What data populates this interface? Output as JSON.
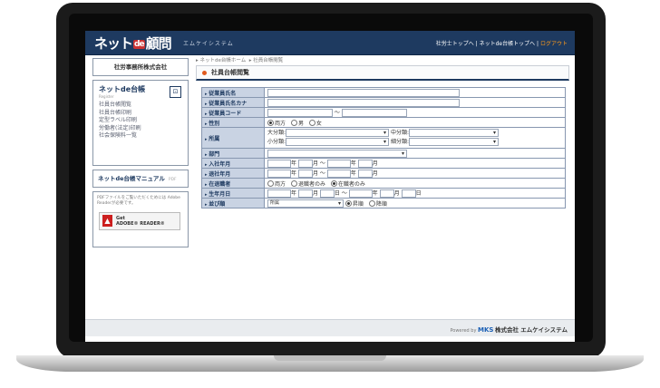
{
  "header": {
    "brand_left": "ネット",
    "brand_de": "de",
    "brand_right": "顧問",
    "company": "エムケイシステム",
    "link_top1": "社労士トップへ",
    "link_sep1": "|",
    "link_top2": "ネットde台帳トップへ",
    "link_sep2": "|",
    "logout": "ログアウト"
  },
  "sidebar": {
    "office": "社労事務所株式会社",
    "nd_title": "ネットde台帳",
    "nd_sub": "Register",
    "links": [
      "社員台帳閲覧",
      "社員台帳印刷",
      "定型ラベル印刷",
      "労働者(法定)印刷",
      "社会保険料一覧"
    ],
    "manual": "ネットde台帳マニュアル",
    "manual_pdf": "PDF",
    "pdf_note": "PDFファイルをご覧いただくためには Adobe Readerが必要です。",
    "adobe_get": "Get",
    "adobe_reader": "ADOBE® READER®"
  },
  "main": {
    "breadcrumb1": "ネットde台帳ホーム",
    "breadcrumb2": "社員台帳閲覧",
    "title": "社員台帳閲覧",
    "rows": {
      "name": "従業員氏名",
      "kana": "従業員氏名カナ",
      "code": "従業員コード",
      "gender": "性別",
      "section": "所属",
      "dept": "部門",
      "joined": "入社年月",
      "left": "退社年月",
      "status": "在退職者",
      "birth": "生年月日",
      "sort": "並び順"
    },
    "code_sep": "〜",
    "gender_opts": [
      "両方",
      "男",
      "女"
    ],
    "section_major": "大分類:",
    "section_mid": "中分類:",
    "section_minor": "小分類:",
    "section_detail": "細分類:",
    "year": "年",
    "month": "月",
    "day": "日",
    "range_sep": "〜",
    "status_opts": [
      "両方",
      "退職者のみ",
      "在職者のみ"
    ],
    "sort_value": "所属",
    "sort_opts": [
      "昇順",
      "降順"
    ]
  },
  "footer": {
    "powered": "Powered by",
    "mks": "MKS",
    "company": "株式会社 エムケイシステム"
  }
}
